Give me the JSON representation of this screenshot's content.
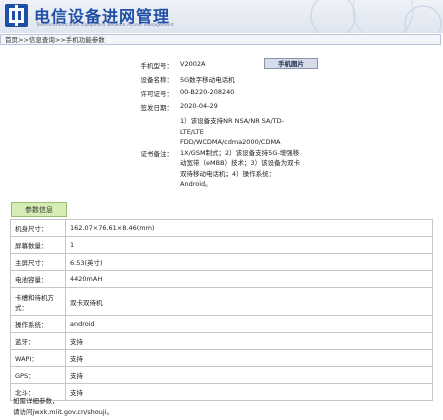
{
  "header": {
    "site_title": "电信设备进网管理",
    "site_subtitle": "Telecommunication Equipment Network Access Management"
  },
  "breadcrumb": "首页>>信息查询>>手机功能参数",
  "device_info": {
    "model_label": "手机型号：",
    "model": "V2002A",
    "name_label": "设备名称：",
    "name": "5G数字移动电话机",
    "license_label": "许可证号：",
    "license": "00-B220-208240",
    "date_label": "签发日期：",
    "date": "2020-04-29",
    "remark_label": "证书备注：",
    "remark": "1）该设备支持NR NSA/NR SA/TD-LTE/LTE FDD/WCDMA/cdma2000/CDMA 1X/GSM制式；2）该设备支持5G-增强移动宽带（eMBB）技术；3）该设备为双卡双待移动电话机；4）操作系统：Android。",
    "phone_image_button": "手机图片"
  },
  "params": {
    "tab_label": "参数信息",
    "rows": [
      {
        "key": "机身尺寸：",
        "value": "162.07×76.61×8.46(mm)"
      },
      {
        "key": "屏幕数量：",
        "value": "1"
      },
      {
        "key": "主屏尺寸：",
        "value": "6.53(英寸)"
      },
      {
        "key": "电池容量：",
        "value": "4420mAH"
      },
      {
        "key": "卡槽和待机方式：",
        "value": "双卡双待机"
      },
      {
        "key": "操作系统：",
        "value": "android"
      },
      {
        "key": "蓝牙：",
        "value": "支持"
      },
      {
        "key": "WAPI：",
        "value": "支持"
      },
      {
        "key": "GPS：",
        "value": "支持"
      },
      {
        "key": "北斗：",
        "value": "支持"
      }
    ]
  },
  "footer": {
    "line1": "如需详细参数，",
    "line2": "请访问jwxk.miit.gov.cn/shouji。"
  }
}
